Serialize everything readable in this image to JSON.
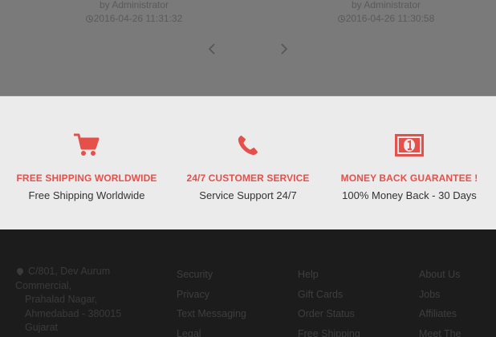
{
  "blog": {
    "posts": [
      {
        "author": "by Administrator",
        "datetime": "2016-04-26 11:31:32"
      },
      {
        "author": "by Administrator",
        "datetime": "2016-04-26 11:30:58"
      }
    ],
    "prev_icon": "chevron-left-icon",
    "next_icon": "chevron-right-icon"
  },
  "services": [
    {
      "icon": "cart-icon",
      "heading": "FREE SHIPPING WORLDWIDE",
      "text": "Free Shipping Worldwide"
    },
    {
      "icon": "phone-icon",
      "heading": "24/7 CUSTOMER SERVICE",
      "text": "Service Support 24/7"
    },
    {
      "icon": "money-icon",
      "heading": "MONEY BACK GUARANTEE !",
      "text": "100% Money Back - 30 Days"
    }
  ],
  "colors": {
    "accent": "#e6504a",
    "footer_bg": "#1c1c1c",
    "services_bg": "#ebebeb"
  },
  "footer": {
    "address": {
      "line1": "C/801, Dev Aurum",
      "line2": "Commercial,",
      "line3": "Prahalad Nagar,",
      "line4": "Ahmedabad - 380015",
      "line5": "Gujarat"
    },
    "col1": [
      "Security",
      "Privacy",
      "Text Messaging",
      "Legal"
    ],
    "col2": [
      "Help",
      "Gift Cards",
      "Order Status",
      "Free Shipping"
    ],
    "col3": [
      "About Us",
      "Jobs",
      "Affiliates",
      "Meet The"
    ]
  }
}
